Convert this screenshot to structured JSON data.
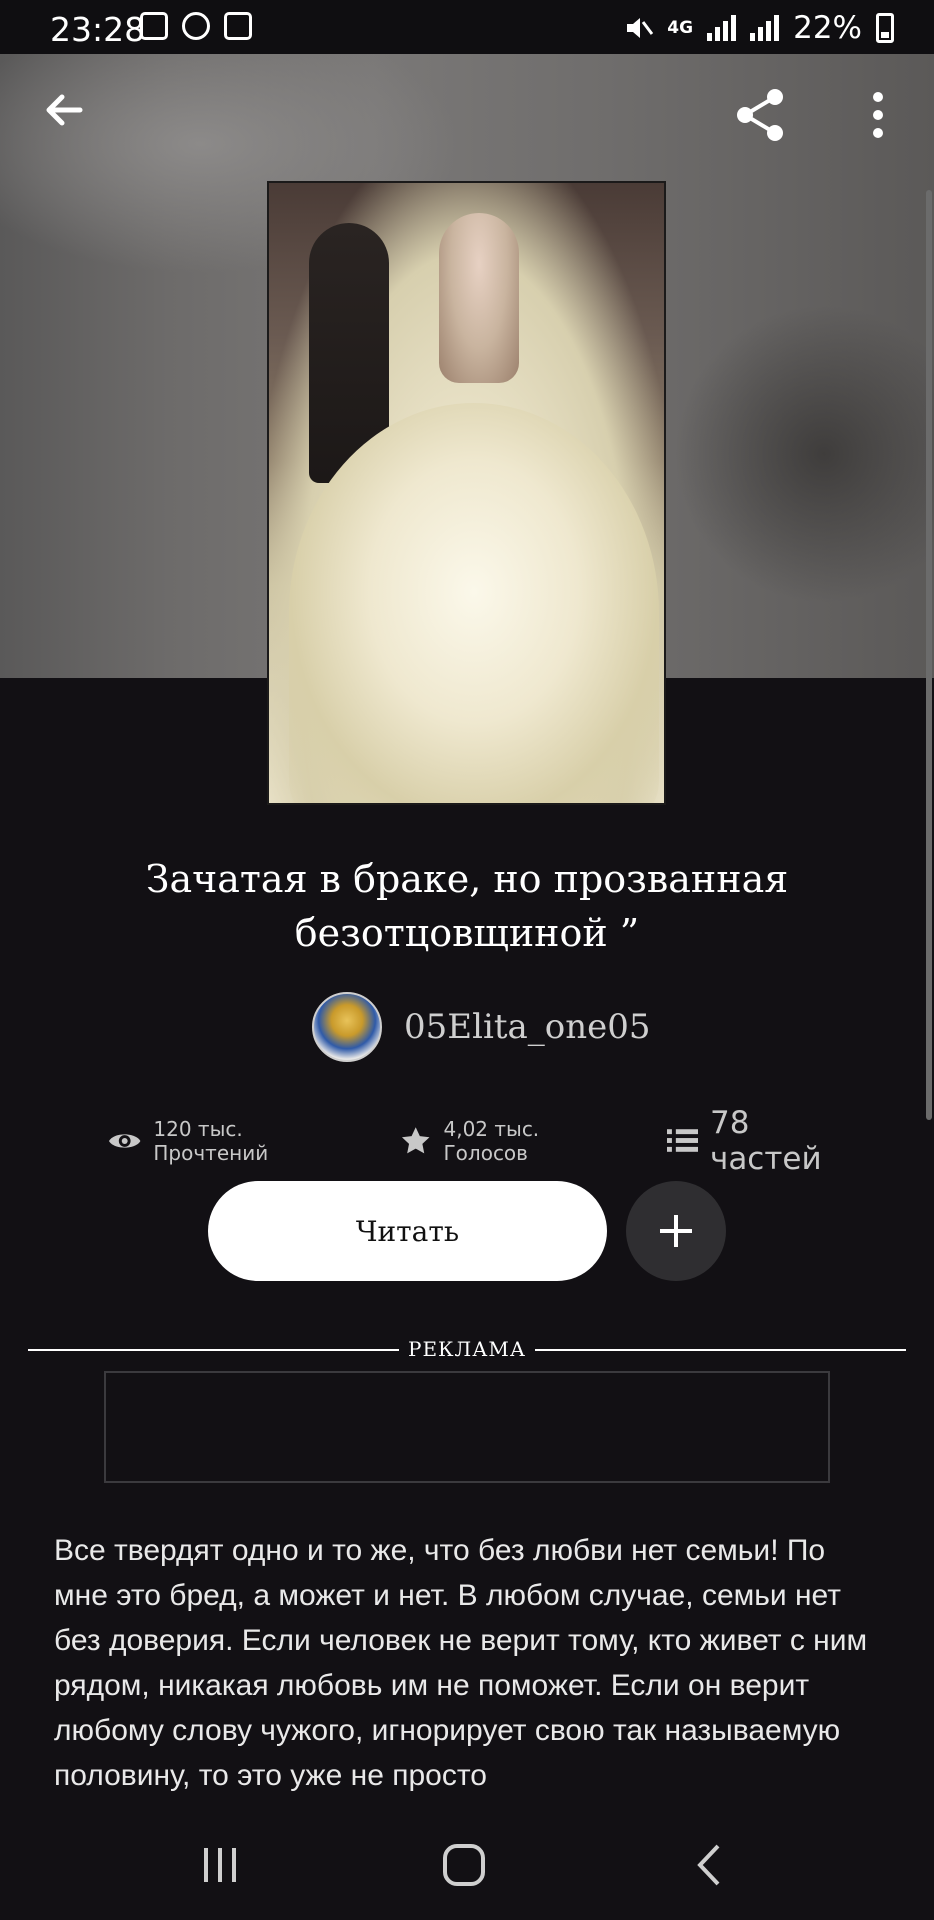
{
  "status_bar": {
    "time": "23:28",
    "network": "4G",
    "battery": "22%"
  },
  "story": {
    "title": "Зачатая в браке, но прозванная безотцовщиной ”",
    "author": "05Elita_one05",
    "stats": {
      "reads": "120 тыс. Прочтений",
      "votes": "4,02 тыс. Голосов",
      "parts": "78 частей"
    },
    "description": "Все твердят одно и то же, что без любви нет семьи! По мне это бред, а может и нет. В любом случае, семьи нет без доверия. Если человек не верит тому, кто живет с ним рядом, никакая любовь им не поможет. Если он верит любому слову чужого, игнорирует свою так называемую половину, то это уже не просто"
  },
  "actions": {
    "read_label": "Читать"
  },
  "ad": {
    "label": "РЕКЛАМА"
  },
  "icons": [
    "back-arrow-icon",
    "share-icon",
    "more-vert-icon",
    "eye-icon",
    "star-icon",
    "list-icon",
    "plus-icon",
    "recent-apps-icon",
    "home-icon",
    "back-nav-icon"
  ]
}
